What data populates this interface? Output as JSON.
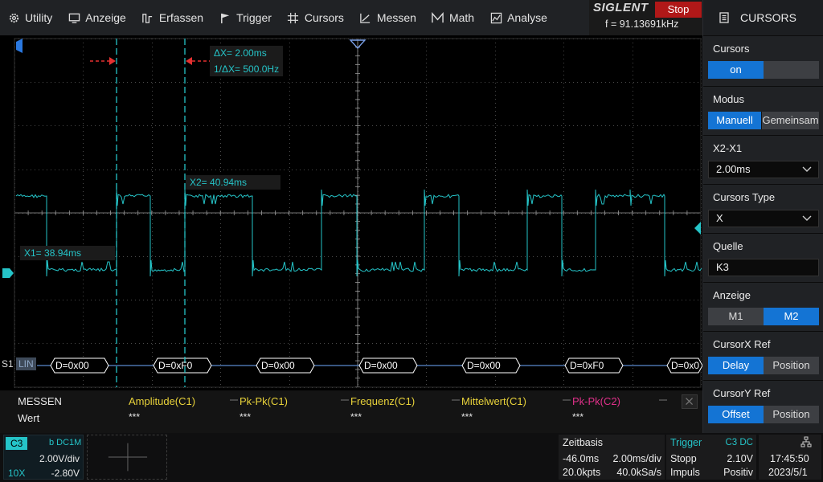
{
  "menu": [
    {
      "label": "Utility",
      "icon": "gear-icon"
    },
    {
      "label": "Anzeige",
      "icon": "display-icon"
    },
    {
      "label": "Erfassen",
      "icon": "acquire-icon"
    },
    {
      "label": "Trigger",
      "icon": "flag-icon"
    },
    {
      "label": "Cursors",
      "icon": "crosshair-icon"
    },
    {
      "label": "Messen",
      "icon": "measure-icon"
    },
    {
      "label": "Math",
      "icon": "math-icon"
    },
    {
      "label": "Analyse",
      "icon": "analyse-icon"
    }
  ],
  "brand": {
    "logo": "SIGLENT",
    "run_state": "Stop",
    "frequency": "f = 91.13691kHz"
  },
  "panel": {
    "title": "CURSORS",
    "sections": {
      "cursors": {
        "label": "Cursors",
        "options": [
          "on",
          ""
        ],
        "selected": 0
      },
      "modus": {
        "label": "Modus",
        "options": [
          "Manuell",
          "Gemeinsam"
        ],
        "selected": 0
      },
      "x2x1": {
        "label": "X2-X1",
        "value": "2.00ms"
      },
      "ctype": {
        "label": "Cursors Type",
        "value": "X"
      },
      "quelle": {
        "label": "Quelle",
        "value": "K3"
      },
      "anzeige": {
        "label": "Anzeige",
        "options": [
          "M1",
          "M2"
        ],
        "selected": 1
      },
      "cxref": {
        "label": "CursorX Ref",
        "options": [
          "Delay",
          "Position"
        ],
        "selected": 0
      },
      "cyref": {
        "label": "CursorY Ref",
        "options": [
          "Offset",
          "Position"
        ],
        "selected": 0
      }
    }
  },
  "cursors": {
    "dx": "ΔX= 2.00ms",
    "inv_dx": "1/ΔX= 500.0Hz",
    "x2": "X2= 40.94ms",
    "x1": "X1= 38.94ms"
  },
  "decode": {
    "slot": "S1",
    "mode": "LIN",
    "frames": [
      "D=0x00",
      "D=0xF0",
      "D=0x00",
      "D=0x00",
      "D=0x00",
      "D=0xF0",
      "D=0x0"
    ]
  },
  "measure": {
    "title": "MESSEN",
    "row_label": "Wert",
    "columns": [
      {
        "name": "Amplitude(C1)",
        "value": "***",
        "color": "#e8d23a"
      },
      {
        "name": "Pk-Pk(C1)",
        "value": "***",
        "color": "#e8d23a"
      },
      {
        "name": "Frequenz(C1)",
        "value": "***",
        "color": "#e8d23a"
      },
      {
        "name": "Mittelwert(C1)",
        "value": "***",
        "color": "#e8d23a"
      },
      {
        "name": "Pk-Pk(C2)",
        "value": "***",
        "color": "#e0308a"
      }
    ]
  },
  "channel": {
    "name": "C3",
    "coupling": "b DC1M",
    "scale": "2.00V/div",
    "probe": "10X",
    "offset": "-2.80V",
    "color": "#25c4c8"
  },
  "timebase": {
    "title": "Zeitbasis",
    "delay": "-46.0ms",
    "scale": "2.00ms/div",
    "points": "20.0kpts",
    "rate": "40.0kSa/s"
  },
  "trigger": {
    "title": "Trigger",
    "source": "C3 DC",
    "mode": "Stopp",
    "level": "2.10V",
    "type": "Impuls",
    "slope": "Positiv"
  },
  "clock": {
    "time": "17:45:50",
    "date": "2023/5/1",
    "icon": "network-icon"
  }
}
